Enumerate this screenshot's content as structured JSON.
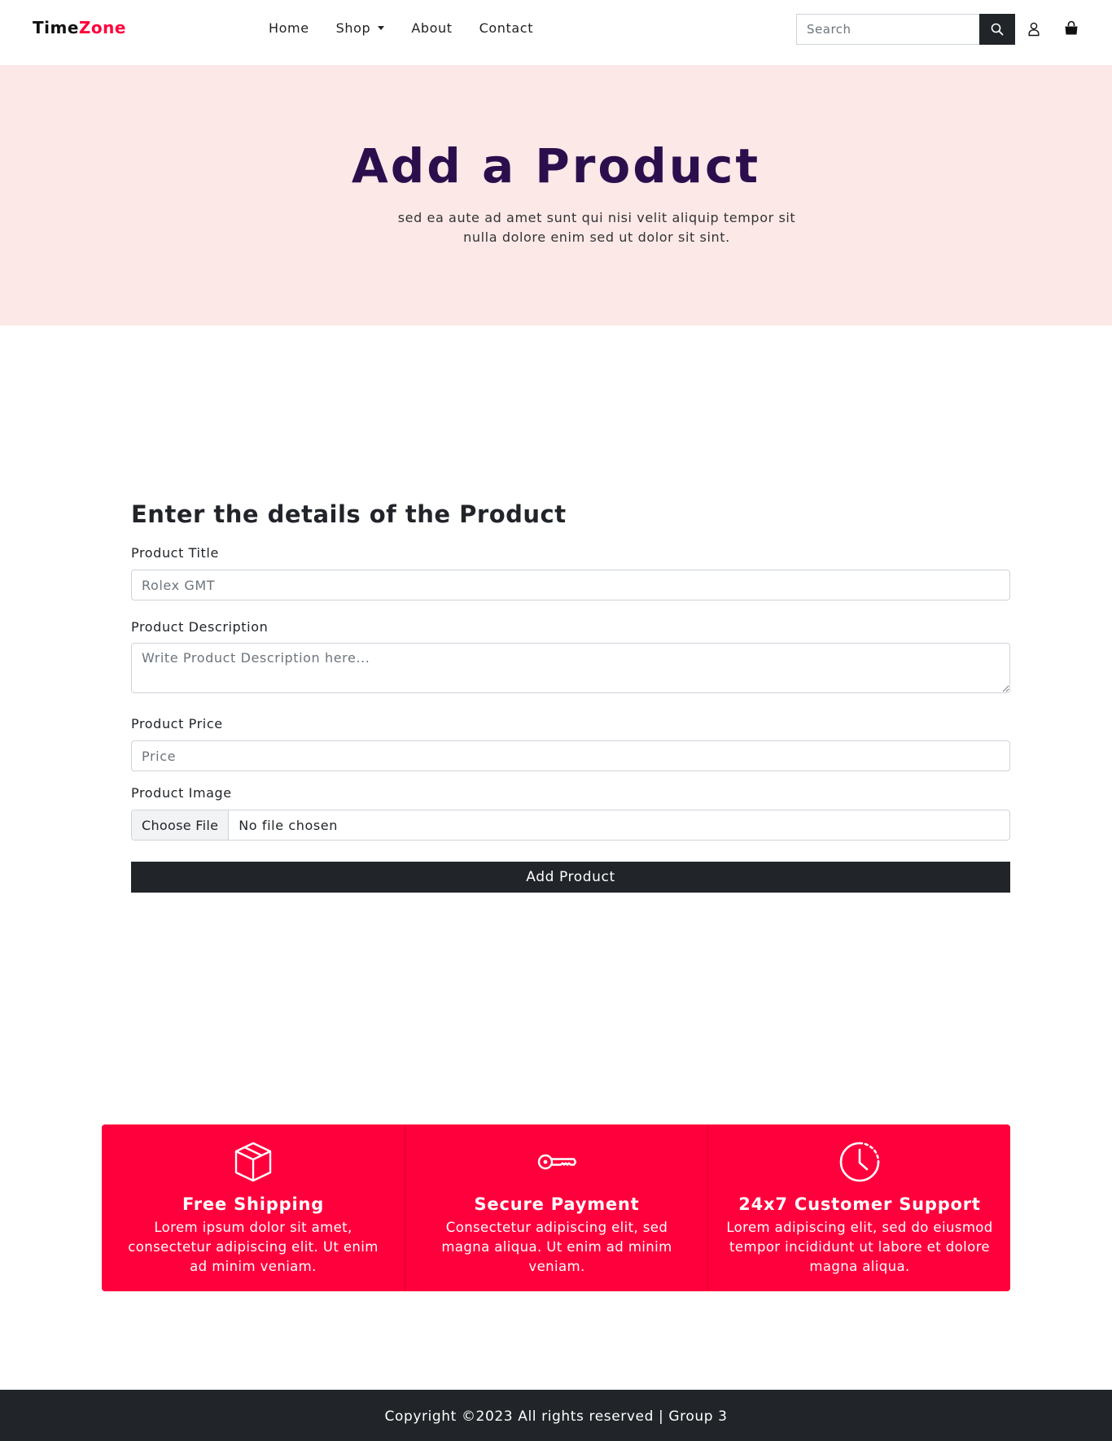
{
  "navbar": {
    "brand_main": "Time",
    "brand_accent": "Zone",
    "links": [
      {
        "label": "Home"
      },
      {
        "label": "Shop"
      },
      {
        "label": "About"
      },
      {
        "label": "Contact"
      }
    ],
    "search_placeholder": "Search",
    "icons": [
      "search-icon",
      "user-icon",
      "shopping-bag-icon",
      "chevron-down-icon"
    ]
  },
  "hero": {
    "title": "Add a Product",
    "subtitle": "sed ea aute ad amet sunt qui nisi velit aliquip tempor sit nulla dolore enim sed ut dolor sit sint."
  },
  "form": {
    "heading": "Enter the details of the Product",
    "title_label": "Product Title",
    "title_placeholder": "Rolex GMT",
    "description_label": "Product Description",
    "description_placeholder": "Write Product Description here...",
    "price_label": "Product Price",
    "price_placeholder": "Price",
    "image_label": "Product Image",
    "choose_file_label": "Choose File",
    "file_status": "No file chosen",
    "submit_label": "Add Product"
  },
  "features": [
    {
      "icon": "box-icon",
      "title": "Free Shipping",
      "text": "Lorem ipsum dolor sit amet, consectetur adipiscing elit. Ut enim ad minim veniam."
    },
    {
      "icon": "key-icon",
      "title": "Secure Payment",
      "text": "Consectetur adipiscing elit, sed magna aliqua. Ut enim ad minim veniam."
    },
    {
      "icon": "clock-icon",
      "title": "24x7 Customer Support",
      "text": "Lorem adipiscing elit, sed do eiusmod tempor incididunt ut labore et dolore magna aliqua."
    }
  ],
  "footer": {
    "copyright": "Copyright ©2023 All rights reserved | Group 3"
  },
  "colors": {
    "accent": "#ff003c",
    "hero_bg": "#fde8e8",
    "hero_title": "#2b0f4d",
    "dark": "#212529"
  }
}
